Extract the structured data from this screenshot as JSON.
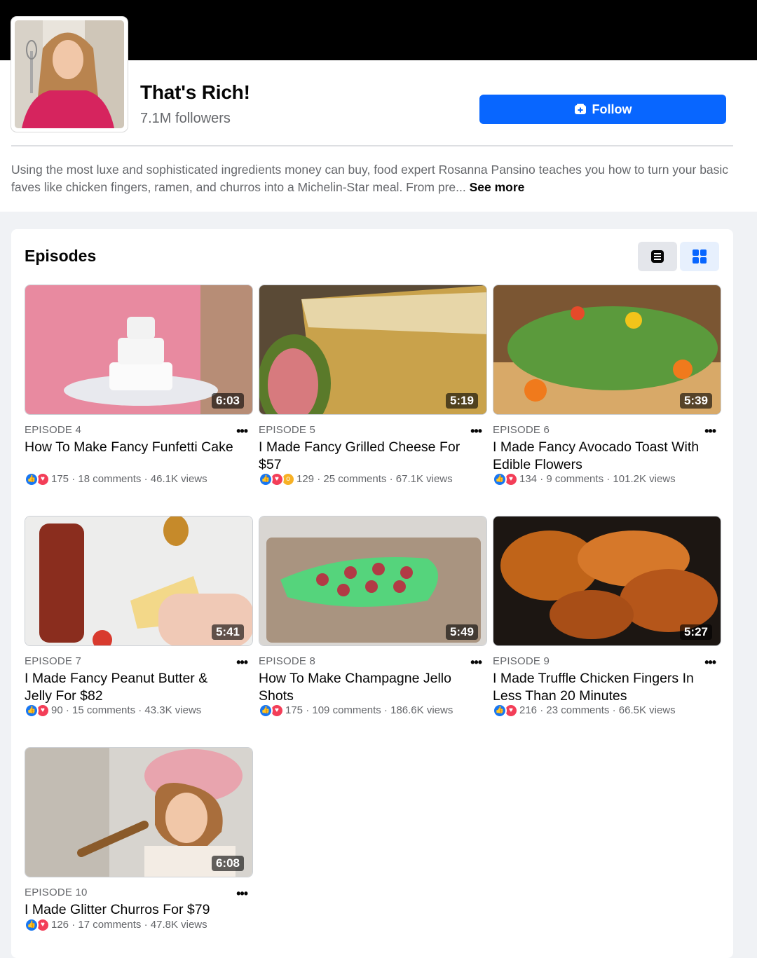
{
  "page": {
    "title": "That's Rich!",
    "followers": "7.1M followers",
    "follow_label": "Follow",
    "description": "Using the most luxe and sophisticated ingredients money can buy, food expert Rosanna Pansino teaches you how to turn your basic faves like chicken fingers, ramen, and churros into a Michelin-Star meal. From pre...",
    "see_more": "See more"
  },
  "episodes_heading": "Episodes",
  "colors": {
    "accent": "#0866ff",
    "like": "#1877f2",
    "love": "#f33e58",
    "wow": "#f7b125"
  },
  "icons": {
    "follow": "follow-icon",
    "list_view": "list-view-icon",
    "grid_view": "grid-view-icon"
  },
  "episodes": [
    {
      "label": "EPISODE 4",
      "title": "How To Make Fancy Funfetti Cake",
      "duration": "6:03",
      "reactions": "175",
      "comments": "18 comments",
      "views": "46.1K views",
      "reaction_icons": [
        "like",
        "love"
      ]
    },
    {
      "label": "EPISODE 5",
      "title": "I Made Fancy Grilled Cheese For $57",
      "duration": "5:19",
      "reactions": "129",
      "comments": "25 comments",
      "views": "67.1K views",
      "reaction_icons": [
        "like",
        "love",
        "wow"
      ]
    },
    {
      "label": "EPISODE 6",
      "title": "I Made Fancy Avocado Toast With Edible Flowers",
      "duration": "5:39",
      "reactions": "134",
      "comments": "9 comments",
      "views": "101.2K views",
      "reaction_icons": [
        "like",
        "love"
      ]
    },
    {
      "label": "EPISODE 7",
      "title": "I Made Fancy Peanut Butter & Jelly For $82",
      "duration": "5:41",
      "reactions": "90",
      "comments": "15 comments",
      "views": "43.3K views",
      "reaction_icons": [
        "like",
        "love"
      ]
    },
    {
      "label": "EPISODE 8",
      "title": "How To Make Champagne Jello Shots",
      "duration": "5:49",
      "reactions": "175",
      "comments": "109 comments",
      "views": "186.6K views",
      "reaction_icons": [
        "like",
        "love"
      ]
    },
    {
      "label": "EPISODE 9",
      "title": "I Made Truffle Chicken Fingers In Less Than 20 Minutes",
      "duration": "5:27",
      "reactions": "216",
      "comments": "23 comments",
      "views": "66.5K views",
      "reaction_icons": [
        "like",
        "love"
      ]
    },
    {
      "label": "EPISODE 10",
      "title": "I Made Glitter Churros For $79",
      "duration": "6:08",
      "reactions": "126",
      "comments": "17 comments",
      "views": "47.8K views",
      "reaction_icons": [
        "like",
        "love"
      ]
    }
  ]
}
